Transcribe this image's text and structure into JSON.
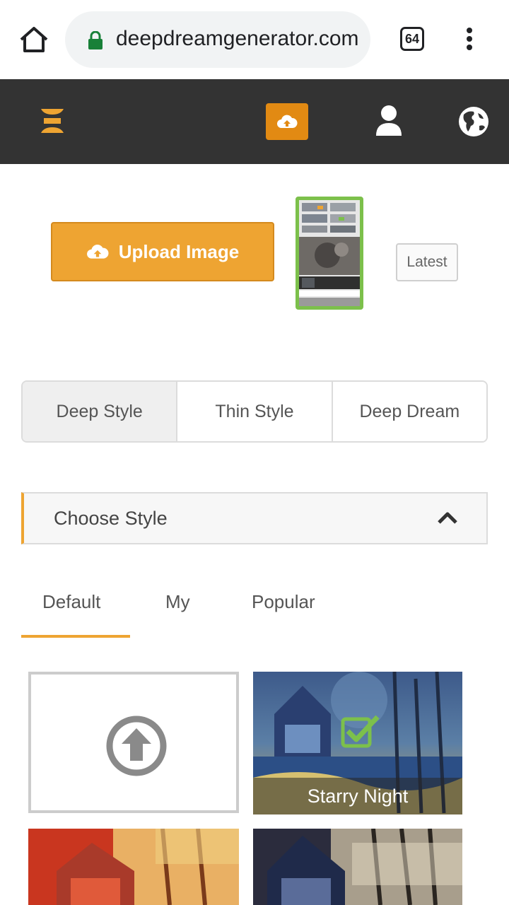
{
  "browser": {
    "url": "deepdreamgenerator.com",
    "tab_count": "64"
  },
  "upload": {
    "button_label": "Upload Image",
    "latest_label": "Latest"
  },
  "modes": [
    {
      "label": "Deep Style",
      "active": true
    },
    {
      "label": "Thin Style",
      "active": false
    },
    {
      "label": "Deep Dream",
      "active": false
    }
  ],
  "choose_style": {
    "label": "Choose Style"
  },
  "style_tabs": [
    {
      "label": "Default",
      "active": true
    },
    {
      "label": "My",
      "active": false
    },
    {
      "label": "Popular",
      "active": false
    }
  ],
  "styles": [
    {
      "name": "Starry Night",
      "selected": true
    }
  ],
  "colors": {
    "accent": "#eea432",
    "header_bg": "#333333",
    "selected_check": "#7cc04b"
  }
}
